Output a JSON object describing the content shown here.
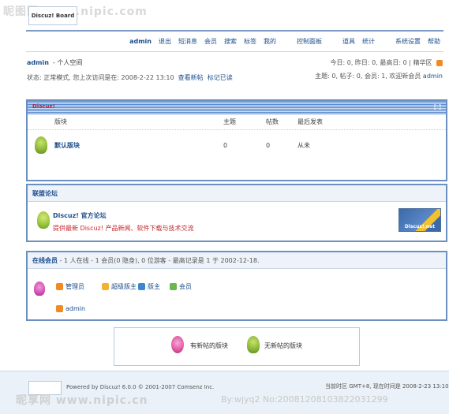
{
  "watermark": {
    "top": "昵图网 www.nipic.com",
    "bottom": "昵享网 www.nipic.cn",
    "right": "By:wjyq2 No:20081208103822031299"
  },
  "logo": {
    "text": "Discuz! Board"
  },
  "nav": {
    "items": [
      "admin",
      "退出",
      "短消息",
      "会员",
      "搜索",
      "标签",
      "我的",
      "控制面板",
      "道具",
      "统计",
      "系统设置",
      "帮助"
    ]
  },
  "user": {
    "name": "admin",
    "space": "- 个人空间",
    "status": "状态: 正常模式, 您上次访问是在: 2008-2-22 13:10",
    "new_posts": "查看新帖",
    "mark_read": "标记已读"
  },
  "stats": {
    "line1": "今日: 0, 昨日: 0, 最高日: 0  |  精华区",
    "line2": "主题: 0, 帖子: 0, 会员: 1, 欢迎新会员",
    "new_member": "admin"
  },
  "forum": {
    "category": "Discuz!",
    "collapse": "[-]",
    "columns": {
      "board": "版块",
      "topics": "主题",
      "posts": "帖数",
      "last": "最后发表"
    },
    "rows": [
      {
        "name": "默认版块",
        "topics": "0",
        "posts": "0",
        "last": "从未"
      }
    ]
  },
  "links": {
    "title": "联盟论坛",
    "name": "Discuz! 官方论坛",
    "desc": "提供最新 Discuz! 产品新闻、软件下载与技术交流",
    "banner": "Discuz!.net"
  },
  "online": {
    "title": "在线会员",
    "summary": "- 1 人在线 - 1 会员(0 隐身), 0 位游客 - 最高记录是 1 于  2002-12-18.",
    "roles": [
      "管理员",
      "超级版主",
      "版主",
      "会员"
    ],
    "members": [
      "admin"
    ],
    "role_colors": [
      "#f08a24",
      "#f2b237",
      "#3d86d4",
      "#69b84c"
    ]
  },
  "legend": {
    "new": "有新帖的版块",
    "none": "无新帖的版块"
  },
  "footer": {
    "powered": "Powered by Discuz! 6.0.0 © 2001-2007 Comsenz Inc.",
    "time": "当前时区  GMT+8, 现在时间是  2008-2-23 13:10"
  }
}
